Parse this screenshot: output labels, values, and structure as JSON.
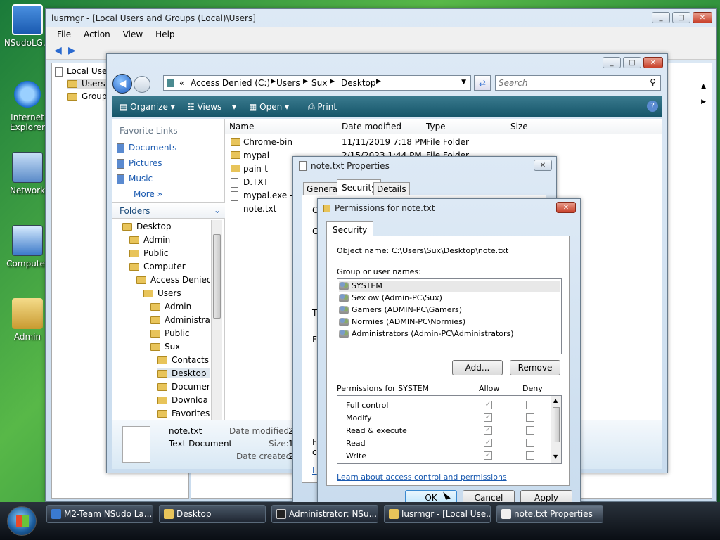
{
  "desktop_icons": [
    {
      "label": "NSudoLG.e",
      "icon": "nsudo-icon"
    },
    {
      "label": "Internet Explorer",
      "icon": "ie-icon"
    },
    {
      "label": "Network",
      "icon": "network-icon"
    },
    {
      "label": "Computer",
      "icon": "computer-icon"
    },
    {
      "label": "Admin",
      "icon": "user-folder-icon"
    }
  ],
  "lusrmgr": {
    "title": "lusrmgr - [Local Users and Groups (Local)\\Users]",
    "menu": [
      "File",
      "Action",
      "View",
      "Help"
    ],
    "tree": [
      "Local User",
      "Users",
      "Group"
    ]
  },
  "explorer": {
    "breadcrumb": [
      "Access Denied (C:)",
      "Users",
      "Sux",
      "Desktop"
    ],
    "search_placeholder": "Search",
    "toolbar": [
      "Organize",
      "Views",
      "Open",
      "Print"
    ],
    "favorite_links_title": "Favorite Links",
    "favorite_links": [
      "Documents",
      "Pictures",
      "Music"
    ],
    "more_label": "More",
    "folders_title": "Folders",
    "folders": [
      {
        "label": "Desktop",
        "indent": 0
      },
      {
        "label": "Admin",
        "indent": 1
      },
      {
        "label": "Public",
        "indent": 1
      },
      {
        "label": "Computer",
        "indent": 1
      },
      {
        "label": "Access Denied",
        "indent": 2
      },
      {
        "label": "Users",
        "indent": 3
      },
      {
        "label": "Admin",
        "indent": 4
      },
      {
        "label": "Administra",
        "indent": 4
      },
      {
        "label": "Public",
        "indent": 4
      },
      {
        "label": "Sux",
        "indent": 4
      },
      {
        "label": "Contacts",
        "indent": 5
      },
      {
        "label": "Desktop",
        "indent": 5
      },
      {
        "label": "Documer",
        "indent": 5
      },
      {
        "label": "Downloa",
        "indent": 5
      },
      {
        "label": "Favorites",
        "indent": 5
      }
    ],
    "columns": [
      "Name",
      "Date modified",
      "Type",
      "Size"
    ],
    "files": [
      {
        "name": "Chrome-bin",
        "date": "11/11/2019 7:18 PM",
        "type": "File Folder",
        "kind": "folder"
      },
      {
        "name": "mypal",
        "date": "2/15/2023 1:44 PM",
        "type": "File Folder",
        "kind": "folder"
      },
      {
        "name": "pain-t",
        "date": "",
        "type": "",
        "kind": "folder"
      },
      {
        "name": "D.TXT",
        "date": "",
        "type": "",
        "kind": "file"
      },
      {
        "name": "mypal.exe - S",
        "date": "",
        "type": "",
        "kind": "shortcut"
      },
      {
        "name": "note.txt",
        "date": "",
        "type": "",
        "kind": "file"
      }
    ],
    "details": {
      "filename": "note.txt",
      "filetype": "Text Document",
      "date_modified_label": "Date modified:",
      "date_modified_value": "2",
      "size_label": "Size:",
      "size_value": "1",
      "date_created_label": "Date created:",
      "date_created_value": "2"
    }
  },
  "properties": {
    "title": "note.txt Properties",
    "tabs": [
      "General",
      "Security",
      "Details"
    ],
    "partial_letters": [
      "C",
      "G",
      "T",
      "F",
      "F",
      "c",
      "L"
    ]
  },
  "permissions": {
    "title": "Permissions for note.txt",
    "tab": "Security",
    "object_name_label": "Object name:",
    "object_name_value": "C:\\Users\\Sux\\Desktop\\note.txt",
    "group_label": "Group or user names:",
    "users": [
      "SYSTEM",
      "Sex ow (Admin-PC\\Sux)",
      "Gamers (ADMIN-PC\\Gamers)",
      "Normies (ADMIN-PC\\Normies)",
      "Administrators (Admin-PC\\Administrators)"
    ],
    "add_label": "Add...",
    "remove_label": "Remove",
    "perm_label": "Permissions for SYSTEM",
    "allow_label": "Allow",
    "deny_label": "Deny",
    "perms": [
      "Full control",
      "Modify",
      "Read & execute",
      "Read",
      "Write"
    ],
    "link": "Learn about access control and permissions",
    "ok_label": "OK",
    "cancel_label": "Cancel",
    "apply_label": "Apply"
  },
  "taskbar": [
    {
      "label": "M2-Team NSudo La...",
      "color": "#3a7ad0"
    },
    {
      "label": "Desktop",
      "color": "#e8c45a"
    },
    {
      "label": "Administrator: NSu...",
      "color": "#222222"
    },
    {
      "label": "lusrmgr - [Local Use...",
      "color": "#e8c45a"
    },
    {
      "label": "note.txt Properties",
      "color": "#f0f0f0"
    }
  ]
}
